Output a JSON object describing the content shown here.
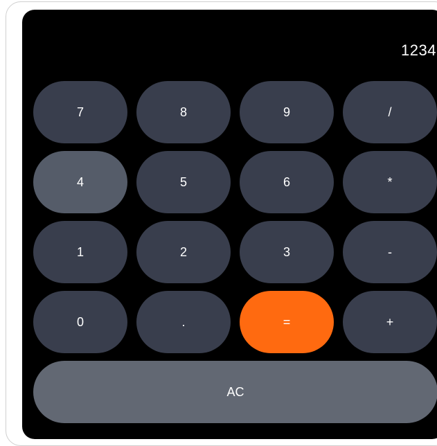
{
  "display": {
    "value": "1234"
  },
  "keys": {
    "k7": "7",
    "k8": "8",
    "k9": "9",
    "div": "/",
    "k4": "4",
    "k5": "5",
    "k6": "6",
    "mul": "*",
    "k1": "1",
    "k2": "2",
    "k3": "3",
    "sub": "-",
    "k0": "0",
    "dot": ".",
    "eq": "=",
    "add": "+",
    "ac": "AC"
  },
  "colors": {
    "background": "#000000",
    "key": "#393e4d",
    "key_highlight": "#555c69",
    "equals": "#ff6a10",
    "clear": "#626873",
    "text": "#ffffff"
  }
}
